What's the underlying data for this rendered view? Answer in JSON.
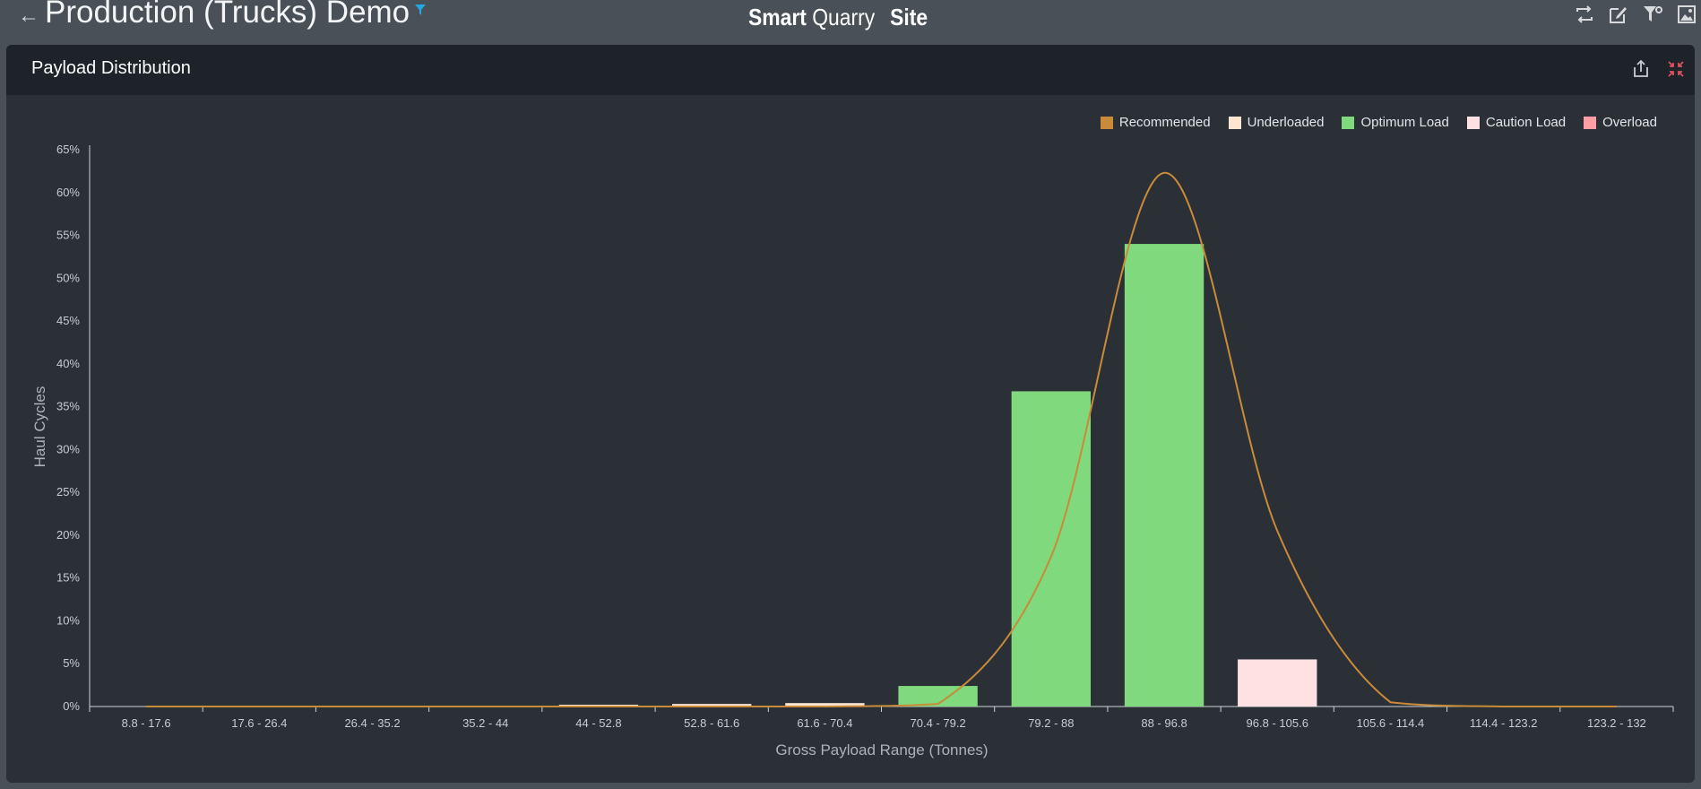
{
  "header": {
    "back_icon": "arrow-left-icon",
    "title": "Production (Trucks) Demo",
    "brand_bold": "Smart",
    "brand_regular": "Quarry",
    "site": "Site",
    "icons": [
      "swap-icon",
      "edit-icon",
      "filter-settings-icon",
      "image-export-icon"
    ]
  },
  "panel": {
    "title": "Payload Distribution",
    "icons": [
      "export-icon",
      "collapse-icon"
    ]
  },
  "colors": {
    "recommended": "#c98a3a",
    "underloaded": "#fce6d2",
    "optimum": "#80d97c",
    "caution": "#ffe0e3",
    "overload": "#ff9ea4",
    "accent_filter": "#22a7e0",
    "collapse_red": "#e05060"
  },
  "chart_data": {
    "type": "bar",
    "xlabel": "Gross Payload Range (Tonnes)",
    "ylabel": "Haul Cycles",
    "ylim": [
      0,
      65
    ],
    "y_ticks": [
      "0%",
      "5%",
      "10%",
      "15%",
      "20%",
      "25%",
      "30%",
      "35%",
      "40%",
      "45%",
      "50%",
      "55%",
      "60%",
      "65%"
    ],
    "categories": [
      "8.8 - 17.6",
      "17.6 - 26.4",
      "26.4 - 35.2",
      "35.2 - 44",
      "44 - 52.8",
      "52.8 - 61.6",
      "61.6 - 70.4",
      "70.4 - 79.2",
      "79.2 - 88",
      "88 - 96.8",
      "96.8 - 105.6",
      "105.6 - 114.4",
      "114.4 - 123.2",
      "123.2 - 132"
    ],
    "values": [
      0,
      0,
      0,
      0,
      0.2,
      0.3,
      0.4,
      2.4,
      36.8,
      54.0,
      5.5,
      0,
      0,
      0
    ],
    "bar_classes": [
      "underloaded",
      "underloaded",
      "underloaded",
      "underloaded",
      "underloaded",
      "underloaded",
      "underloaded",
      "optimum",
      "optimum",
      "optimum",
      "caution",
      "caution",
      "overload",
      "overload"
    ],
    "recommended_curve": [
      0,
      0,
      0,
      0,
      0,
      0,
      0,
      0.3,
      17.5,
      62.3,
      20.5,
      0.5,
      0,
      0
    ],
    "grid": false,
    "legend_position": "top-right",
    "legend": [
      {
        "label": "Recommended",
        "color": "#c98a3a"
      },
      {
        "label": "Underloaded",
        "color": "#fce6d2"
      },
      {
        "label": "Optimum Load",
        "color": "#80d97c"
      },
      {
        "label": "Caution Load",
        "color": "#ffe0e3"
      },
      {
        "label": "Overload",
        "color": "#ff9ea4"
      }
    ]
  }
}
